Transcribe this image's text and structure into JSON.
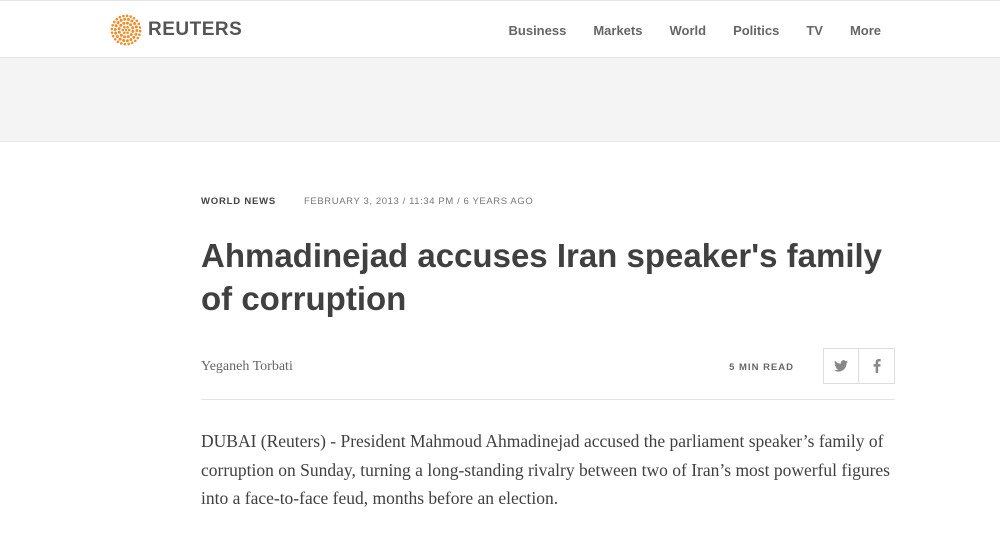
{
  "brand": {
    "name": "REUTERS",
    "logo_icon": "reuters-dots-logo-icon",
    "accent_color": "#f28c28"
  },
  "nav": {
    "items": [
      {
        "label": "Business"
      },
      {
        "label": "Markets"
      },
      {
        "label": "World"
      },
      {
        "label": "Politics"
      },
      {
        "label": "TV"
      },
      {
        "label": "More"
      }
    ]
  },
  "article": {
    "section": "WORLD NEWS",
    "dateline": "FEBRUARY 3, 2013 / 11:34 PM / 6 YEARS AGO",
    "headline": "Ahmadinejad accuses Iran speaker's family of corruption",
    "author": "Yeganeh Torbati",
    "read_time": "5 MIN READ",
    "share": [
      {
        "icon": "twitter-icon"
      },
      {
        "icon": "facebook-icon"
      }
    ],
    "lead": "DUBAI (Reuters) - President Mahmoud Ahmadinejad accused the parliament speaker’s family of corruption on Sunday, turning a long-standing rivalry between two of Iran’s most powerful figures into a face-to-face feud, months before an election."
  }
}
